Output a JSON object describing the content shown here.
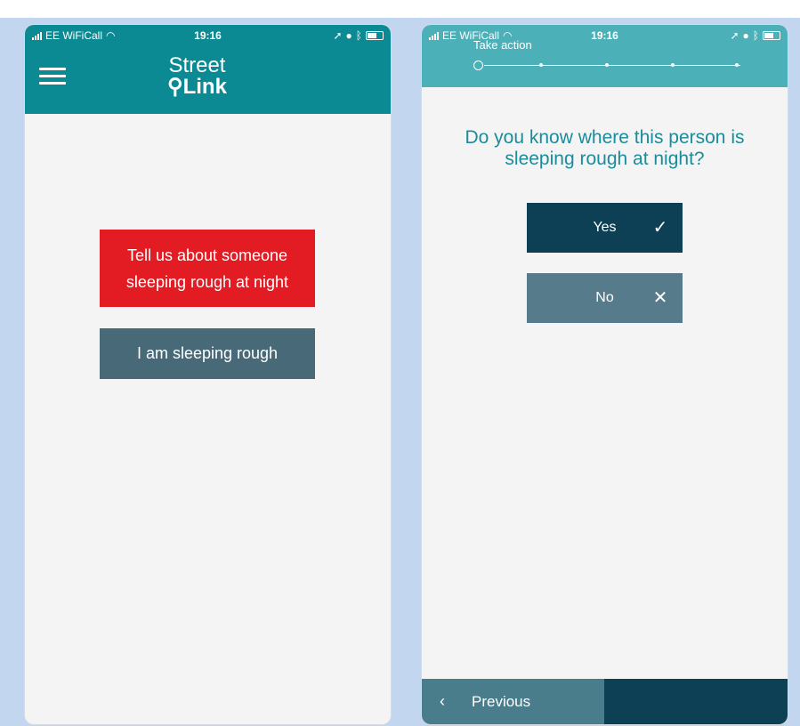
{
  "phone1": {
    "status": {
      "carrier": "EE WiFiCall",
      "time": "19:16"
    },
    "header": {
      "logo_line1": "Street",
      "logo_line2": "Link"
    },
    "buttons": {
      "report_someone": "Tell us about someone sleeping rough at night",
      "self_report": "I am sleeping rough"
    },
    "colors": {
      "header": "#0b8a94",
      "report_button": "#e31b23",
      "self_button": "#486a78"
    }
  },
  "phone2": {
    "status": {
      "carrier": "EE WiFiCall",
      "time": "19:16"
    },
    "header": {
      "step_title": "Take action"
    },
    "question": "Do you know where this person is sleeping rough at night?",
    "options": {
      "yes": {
        "label": "Yes",
        "icon": "check-icon"
      },
      "no": {
        "label": "No",
        "icon": "close-icon"
      }
    },
    "footer": {
      "previous_label": "Previous"
    },
    "colors": {
      "header": "#4cb0b8",
      "question_text": "#1a8c9a",
      "yes_button": "#0d3f55",
      "no_button": "#567c8b"
    }
  }
}
